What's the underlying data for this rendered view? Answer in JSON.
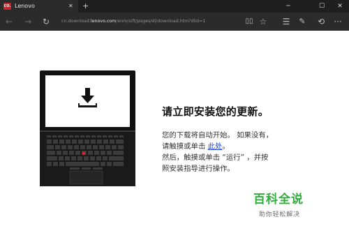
{
  "browser": {
    "tab_title": "Lenovo",
    "tab_favicon_text": "CO.",
    "url_prefix": "cn.download.",
    "url_domain": "lenovo.com",
    "url_suffix": "/enm/sift/pages/dl/download.htm?dlid=1"
  },
  "page": {
    "headline": "请立即安装您的更新。",
    "line1": "您的下载将自动开始。 如果没有，",
    "line2_prefix": "请触摸或单击 ",
    "line2_link": "此处",
    "line2_suffix": "。",
    "line3": "然后，触摸或单击 “运行” ，并按",
    "line4": "照安装指导进行操作。"
  },
  "watermark": {
    "title": "百科全说",
    "subtitle": "助你轻松解决"
  },
  "colors": {
    "brand_red": "#c0262c",
    "watermark_green": "#2fae3c",
    "link_blue": "#1a3cc9",
    "trackpoint_red": "#e0242b"
  }
}
